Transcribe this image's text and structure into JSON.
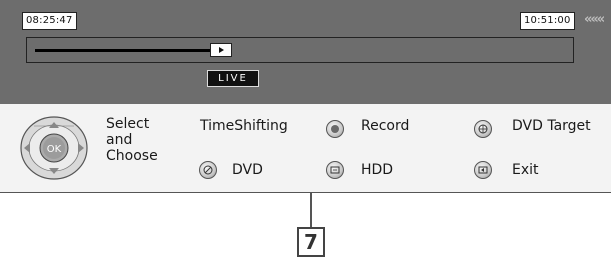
{
  "screen": {
    "elapsed_time": "08:25:47",
    "end_time": "10:51:00",
    "chevron_glyph": "«««",
    "progress_fraction": 0.33,
    "live_label": "LIVE"
  },
  "controls": {
    "ok_label": "OK",
    "select_line1": "Select",
    "select_line2": "and",
    "select_line3": "Choose",
    "timeshifting_label": "TimeShifting",
    "dvd_label": "DVD",
    "record_label": "Record",
    "hdd_label": "HDD",
    "dvd_target_label": "DVD Target",
    "exit_label": "Exit",
    "icons": {
      "record": "record-icon",
      "dvd": "disc-icon",
      "hdd": "hdd-icon",
      "dvd_target": "target-icon",
      "exit": "exit-icon"
    }
  },
  "callout": {
    "number": "7"
  }
}
